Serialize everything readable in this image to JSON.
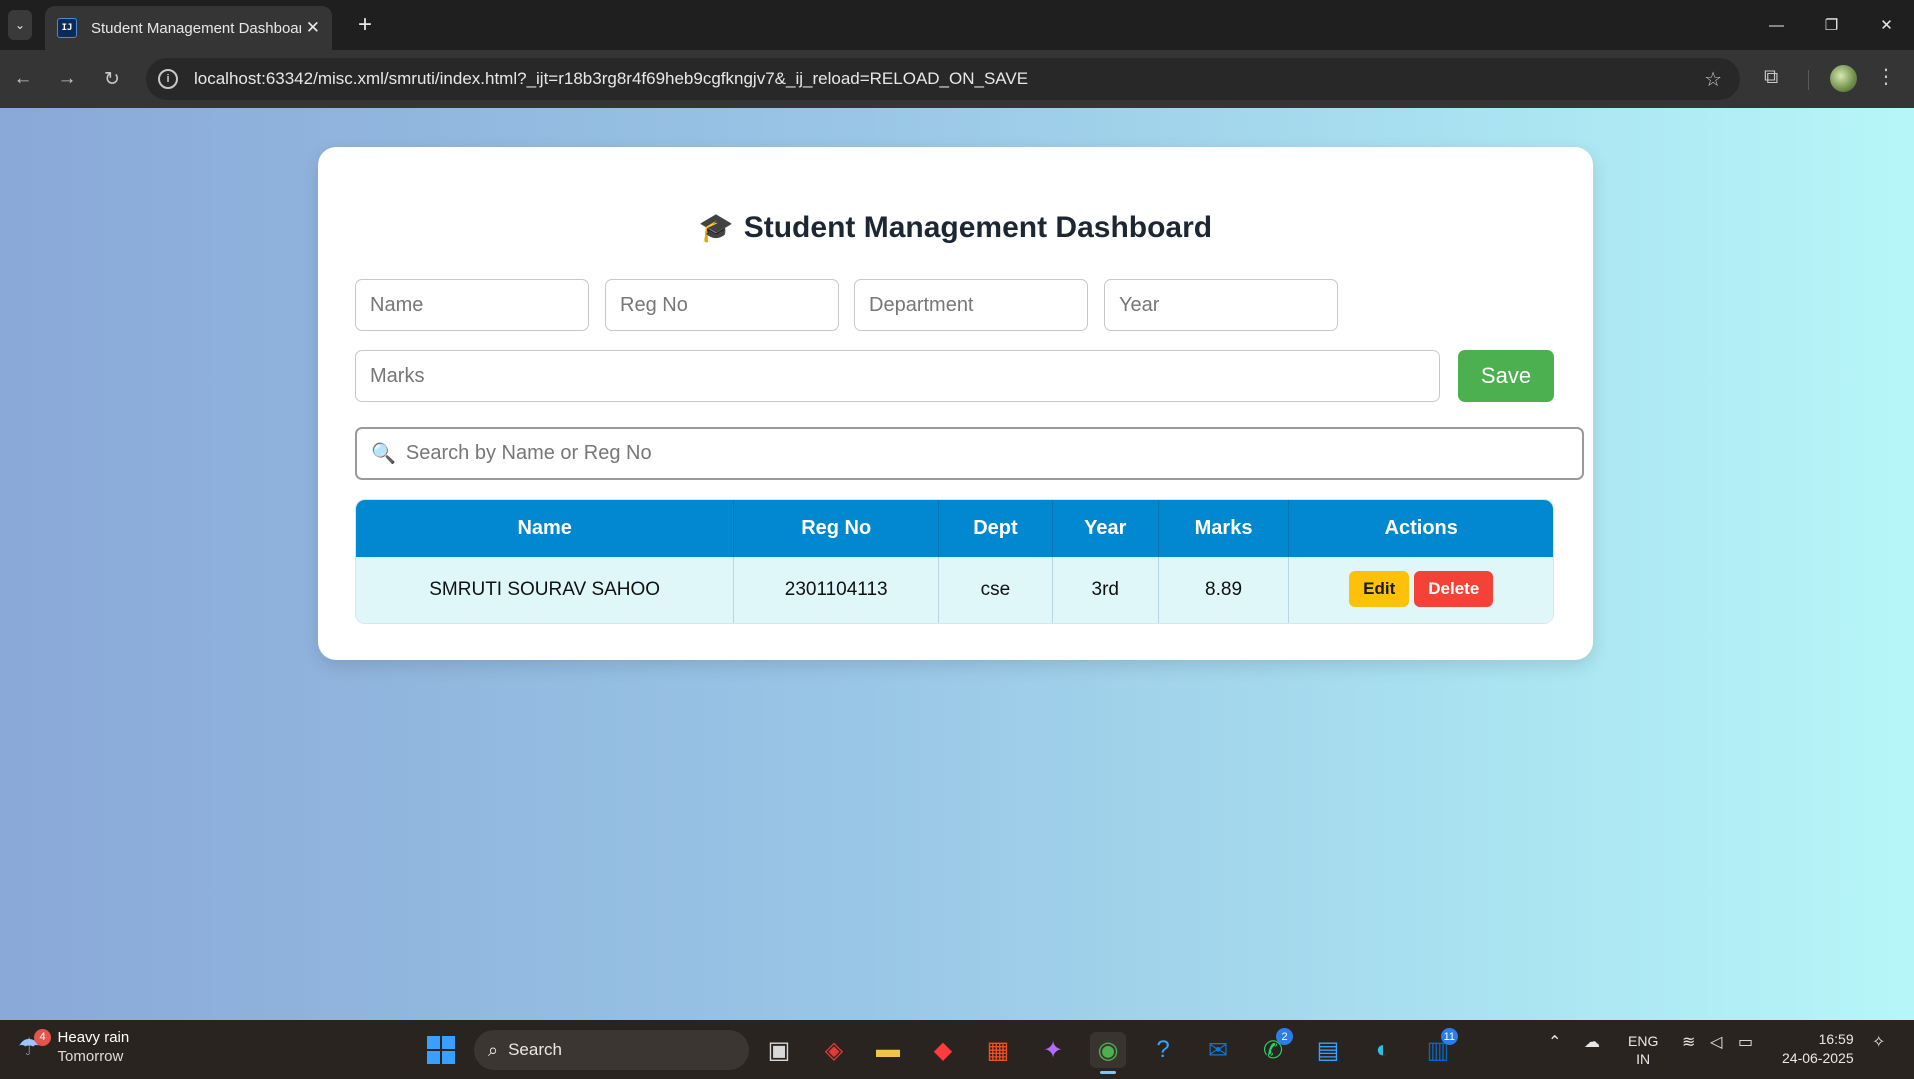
{
  "browser": {
    "tab_title": "Student Management Dashboard",
    "favicon_text": "IJ",
    "url": "localhost:63342/misc.xml/smruti/index.html?_ijt=r18b3rg8r4f69heb9cgfkngjv7&_ij_reload=RELOAD_ON_SAVE",
    "icons": {
      "back": "←",
      "forward": "→",
      "reload": "↻",
      "info": "i",
      "star": "☆",
      "extensions": "⧉",
      "menu": "⋮",
      "new_tab": "+",
      "tab_close": "✕",
      "tab_menu": "⌄",
      "minimize": "—",
      "restore": "❐",
      "close": "✕"
    }
  },
  "page": {
    "title": "Student Management Dashboard",
    "title_icon": "🎓",
    "form": {
      "name_placeholder": "Name",
      "regno_placeholder": "Reg No",
      "department_placeholder": "Department",
      "year_placeholder": "Year",
      "marks_placeholder": "Marks",
      "save_label": "Save"
    },
    "search": {
      "icon": "🔍",
      "placeholder": "Search by Name or Reg No"
    },
    "table": {
      "headers": [
        "Name",
        "Reg No",
        "Dept",
        "Year",
        "Marks",
        "Actions"
      ],
      "rows": [
        {
          "name": "SMRUTI SOURAV SAHOO",
          "regno": "2301104113",
          "dept": "cse",
          "year": "3rd",
          "marks": "8.89",
          "edit_label": "Edit",
          "delete_label": "Delete"
        }
      ]
    },
    "colors": {
      "header_bg": "#0288d1",
      "row_bg": "#e0f7fa",
      "save": "#4caf50",
      "edit": "#ffc107",
      "delete": "#f44336"
    }
  },
  "taskbar": {
    "weather_title": "Heavy rain",
    "weather_subtitle": "Tomorrow",
    "weather_badge": "4",
    "search_label": "Search",
    "whatsapp_badge": "2",
    "linkedin_badge": "11",
    "lang_top": "ENG",
    "lang_bottom": "IN",
    "time": "16:59",
    "date": "24-06-2025"
  }
}
